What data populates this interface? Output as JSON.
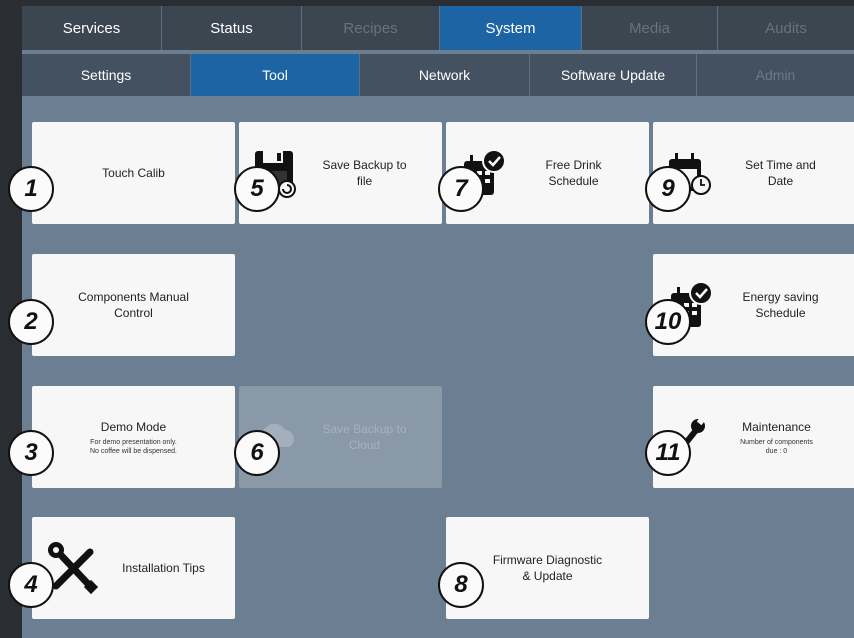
{
  "tabs_top": [
    {
      "label": "Services",
      "state": "normal"
    },
    {
      "label": "Status",
      "state": "normal"
    },
    {
      "label": "Recipes",
      "state": "disabled"
    },
    {
      "label": "System",
      "state": "active"
    },
    {
      "label": "Media",
      "state": "disabled"
    },
    {
      "label": "Audits",
      "state": "disabled"
    }
  ],
  "tabs_sub": [
    {
      "label": "Settings",
      "state": "normal"
    },
    {
      "label": "Tool",
      "state": "active"
    },
    {
      "label": "Network",
      "state": "normal"
    },
    {
      "label": "Software Update",
      "state": "normal"
    },
    {
      "label": "Admin",
      "state": "disabled"
    }
  ],
  "tiles": {
    "touch_calib": {
      "label": "Touch Calib",
      "badge": "1"
    },
    "components_manual": {
      "label": "Components Manual\nControl",
      "badge": "2"
    },
    "demo_mode": {
      "label": "Demo Mode",
      "sub": "For demo presentation only.\nNo coffee will be dispensed.",
      "badge": "3"
    },
    "installation_tips": {
      "label": "Installation Tips",
      "badge": "4"
    },
    "save_backup_file": {
      "label": "Save Backup to\nfile",
      "badge": "5"
    },
    "save_backup_cloud": {
      "label": "Save Backup to\nCloud",
      "badge": "6",
      "state": "disabled"
    },
    "free_drink": {
      "label": "Free Drink\nSchedule",
      "badge": "7"
    },
    "firmware": {
      "label": "Firmware Diagnostic\n& Update",
      "badge": "8"
    },
    "set_time": {
      "label": "Set Time and\nDate",
      "badge": "9"
    },
    "energy_saving": {
      "label": "Energy saving\nSchedule",
      "badge": "10"
    },
    "maintenance": {
      "label": "Maintenance",
      "sub": "Number of components\ndue : 0",
      "badge": "11"
    }
  },
  "colors": {
    "background": "#6b7e92",
    "tab_bar": "#3b4651",
    "active_tab": "#1c64a4",
    "tile": "#f7f7f7",
    "tile_disabled": "#8a99a8"
  }
}
